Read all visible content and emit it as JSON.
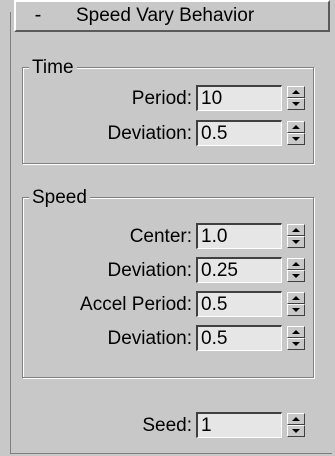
{
  "rollout": {
    "toggle": "-",
    "title": "Speed Vary Behavior"
  },
  "time_group": {
    "legend": "Time",
    "period": {
      "label": "Period:",
      "value": "10"
    },
    "deviation": {
      "label": "Deviation:",
      "value": "0.5"
    }
  },
  "speed_group": {
    "legend": "Speed",
    "center": {
      "label": "Center:",
      "value": "1.0"
    },
    "deviation": {
      "label": "Deviation:",
      "value": "0.25"
    },
    "accel_period": {
      "label": "Accel Period:",
      "value": "0.5"
    },
    "accel_deviation": {
      "label": "Deviation:",
      "value": "0.5"
    }
  },
  "seed": {
    "label": "Seed:",
    "value": "1"
  }
}
